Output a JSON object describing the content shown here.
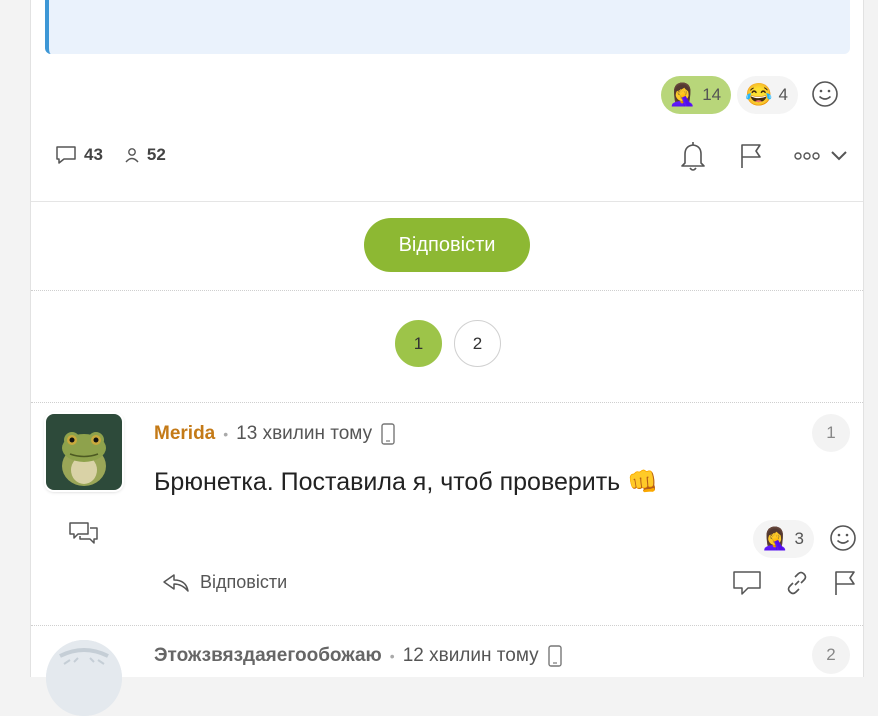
{
  "post": {
    "reactions": [
      {
        "emoji": "🤦‍♀️",
        "count": "14",
        "active": true
      },
      {
        "emoji": "😂",
        "count": "4",
        "active": false
      }
    ],
    "stats": {
      "comments": "43",
      "participants": "52"
    }
  },
  "reply_button": "Відповісти",
  "pagination": {
    "pages": [
      "1",
      "2"
    ],
    "current": "1"
  },
  "comments": [
    {
      "author": "Merida",
      "time": "13 хвилин тому",
      "number": "1",
      "text": "Брюнетка. Поставила я, чтоб проверить",
      "text_emoji": "👊",
      "reaction": {
        "emoji": "🤦‍♀️",
        "count": "3"
      },
      "reply_label": "Відповісти"
    },
    {
      "author": "Этожзвяздаяегообожаю",
      "time": "12 хвилин тому",
      "number": "2"
    }
  ],
  "colors": {
    "accent": "#8db833",
    "author": "#c47a17",
    "quote_border": "#3d97d6"
  }
}
